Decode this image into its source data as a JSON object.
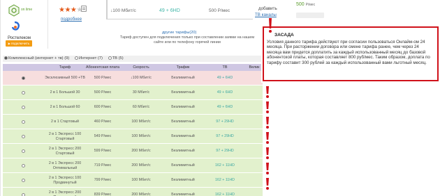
{
  "card": {
    "logo_top_text": "on\nlime",
    "logo_brand": "Ростелеком",
    "connect_label": "подключить",
    "stars_on": "★★★",
    "stars_off": "★",
    "more_link": "подробнее",
    "top_speed": "↓100 Мбит/с",
    "top_tv": "49 + 6HD",
    "top_price": "500 Р/мес",
    "add_label": "добавить",
    "channels_link": "ТВ каналы",
    "price_big": "500",
    "price_unit": "Р/мес",
    "other_tariffs": "другие тарифы(20)",
    "tariff_note": "Тариф доступен для подключения только при составлении заявки на нашем сайте или по телефону горячей линии"
  },
  "filters": {
    "f1": "Комплексный (интернет + тв) (9)",
    "f2": "Интернет (7)",
    "f3": "ТВ (5)"
  },
  "table": {
    "headers": [
      "",
      "Тариф",
      "Абонентская плата",
      "Скорость",
      "Трафик",
      "ТВ",
      "Велик"
    ],
    "rows": [
      {
        "name": "Эксклюзивный 500 +ТВ",
        "fee": "500 Р/мес",
        "speed": "↓100 Мбит/с",
        "traffic": "Безлимитный",
        "tv": "49 + 6HD",
        "selected": true
      },
      {
        "name": "2 в 1 Большой 30",
        "fee": "500 Р/мес",
        "speed": "30 Мбит/с",
        "traffic": "Безлимитный",
        "tv": "49 + 6HD",
        "selected": false
      },
      {
        "name": "2 в 1 Большой 60",
        "fee": "600 Р/мес",
        "speed": "60 Мбит/с",
        "traffic": "Безлимитный",
        "tv": "49 + 6HD",
        "selected": false
      },
      {
        "name": "2 в 1 Стартовый",
        "fee": "460 Р/мес",
        "speed": "100 Мбит/с",
        "traffic": "Безлимитный",
        "tv": "97 + 29HD",
        "selected": false
      },
      {
        "name": "2 в 1 Экспресс 100 Стартовый",
        "fee": "549 Р/мес",
        "speed": "100 Мбит/с",
        "traffic": "Безлимитный",
        "tv": "97 + 29HD",
        "selected": false
      },
      {
        "name": "2 в 1 Экспресс 200 Стартовый",
        "fee": "599 Р/мес",
        "speed": "200 Мбит/с",
        "traffic": "Безлимитный",
        "tv": "97 + 29HD",
        "selected": false
      },
      {
        "name": "2 в 1 Экспресс 200 Оптимальный",
        "fee": "719 Р/мес",
        "speed": "200 Мбит/с",
        "traffic": "Безлимитный",
        "tv": "162 + 11HD",
        "selected": false
      },
      {
        "name": "2 в 1 Экспресс 100 Продвинутый",
        "fee": "799 Р/мес",
        "speed": "100 Мбит/с",
        "traffic": "Безлимитный",
        "tv": "162 + 11HD",
        "selected": false
      },
      {
        "name": "2 в 1 Экспресс 200 Продвинутый",
        "fee": "839 Р/мес",
        "speed": "200 Мбит/с",
        "traffic": "Безлимитный",
        "tv": "162 + 11HD",
        "selected": false
      }
    ]
  },
  "popup": {
    "title": "ЗАСАДА",
    "text": "Условия данного тарифа действуют при согласии пользоваться Онлайм-ом 24 месяца. При расторжении договора или смене тарифа ранее, чем через 24 месяца вам придется доплатить за каждый использованный месяц до базовой абонентской платы, которая составляет 800 руб/мес. Таким образом, доплата по тарифу составит 300 рублей за каждый использованный вами льготный месяц."
  },
  "colors": {
    "alert_red": "#d0111a",
    "header_lilac": "#cfc7e3",
    "row_green": "#e2f1cd",
    "row_pink": "#f7dede",
    "accent_orange": "#f39c12"
  }
}
